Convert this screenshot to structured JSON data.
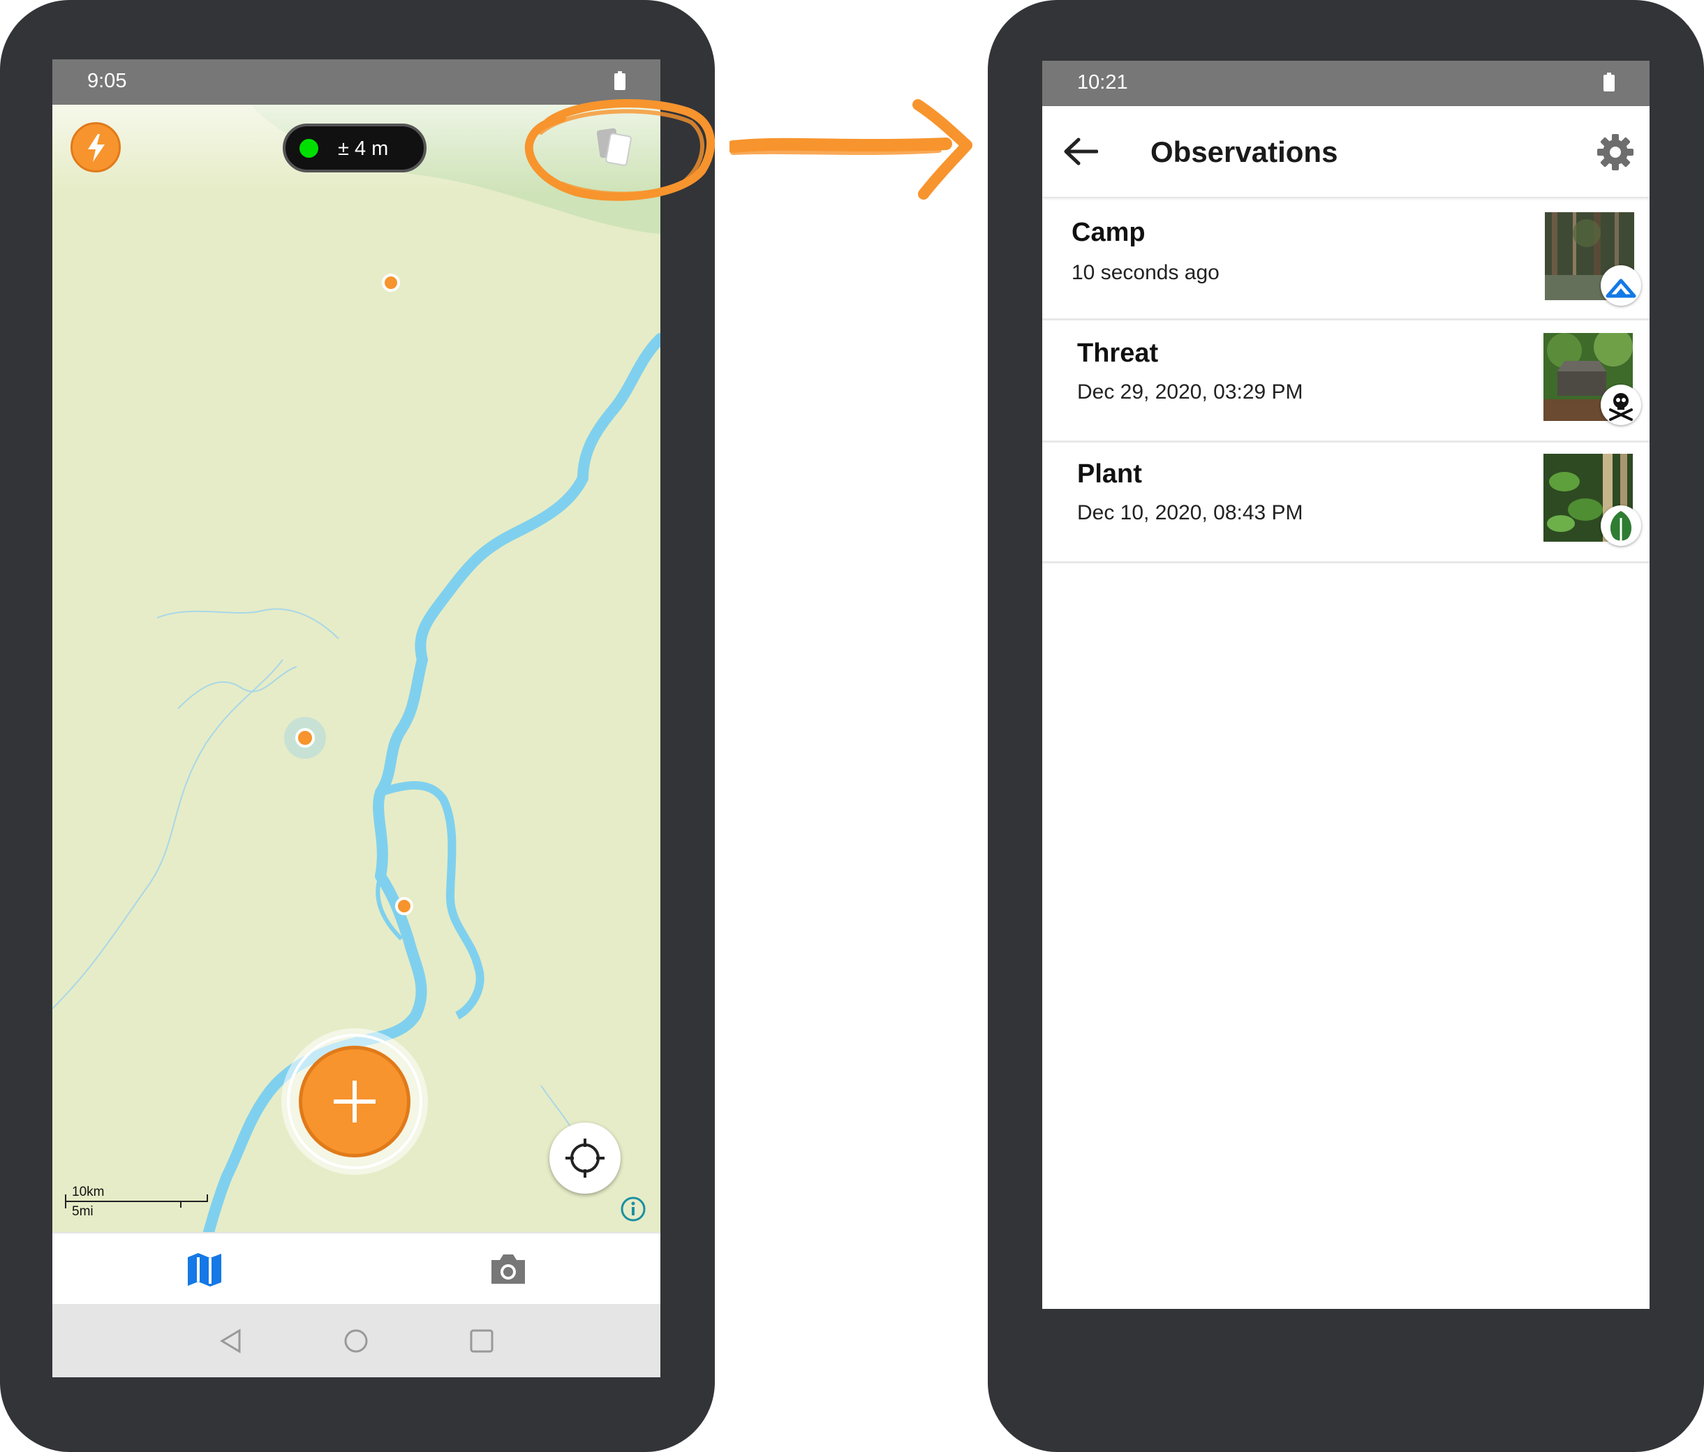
{
  "left_phone": {
    "status_time": "9:05",
    "gps_accuracy": "± 4 m",
    "scale_km": "10km",
    "scale_mi": "5mi",
    "tabs": [
      {
        "icon": "map-icon"
      },
      {
        "icon": "camera-icon"
      }
    ]
  },
  "right_phone": {
    "status_time": "10:21",
    "header_title": "Observations",
    "observations": [
      {
        "title": "Camp",
        "subtitle": "10 seconds ago",
        "icon": "camp-icon"
      },
      {
        "title": "Threat",
        "subtitle": "Dec 29, 2020, 03:29 PM",
        "icon": "skull-crossbones-icon"
      },
      {
        "title": "Plant",
        "subtitle": "Dec 10, 2020, 08:43 PM",
        "icon": "leaf-icon"
      }
    ]
  },
  "colors": {
    "accent_orange": "#f7942d",
    "gps_green": "#00e000",
    "map_blue": "#1478e6",
    "river_blue": "#7fd0ee",
    "map_land": "#e6ecc7"
  }
}
